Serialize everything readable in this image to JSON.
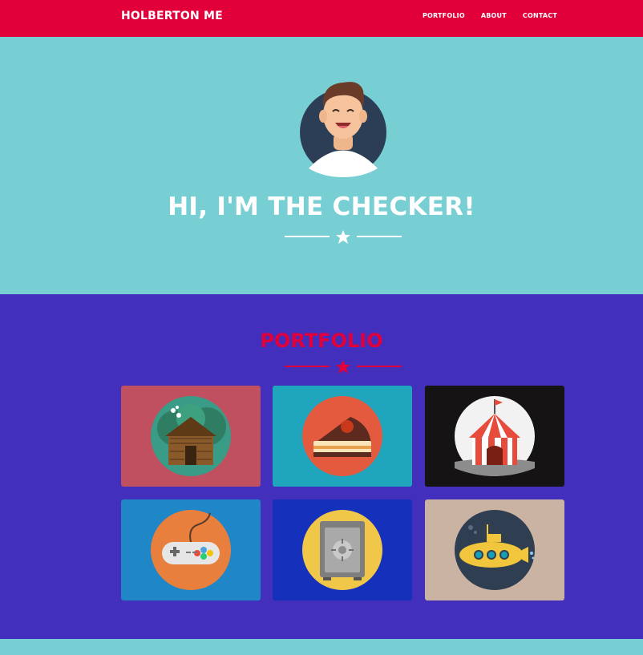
{
  "nav": {
    "brand": "HOLBERTON ME",
    "links": [
      {
        "label": "PORTFOLIO"
      },
      {
        "label": "ABOUT"
      },
      {
        "label": "CONTACT"
      }
    ]
  },
  "hero": {
    "title": "HI, I'M THE CHECKER!"
  },
  "portfolio": {
    "title": "PORTFOLIO",
    "items": [
      {
        "icon": "log-cabin-icon",
        "bg": "#c0505f"
      },
      {
        "icon": "cake-slice-icon",
        "bg": "#1fa6bd"
      },
      {
        "icon": "circus-tent-icon",
        "bg": "#151313"
      },
      {
        "icon": "game-controller-icon",
        "bg": "#1f86c8"
      },
      {
        "icon": "safe-icon",
        "bg": "#1531bb"
      },
      {
        "icon": "submarine-icon",
        "bg": "#cbb3a4"
      }
    ]
  },
  "colors": {
    "nav_bg": "#e2003b",
    "hero_bg": "#77ced3",
    "portfolio_bg": "#4230bd",
    "accent": "#e2003b"
  }
}
